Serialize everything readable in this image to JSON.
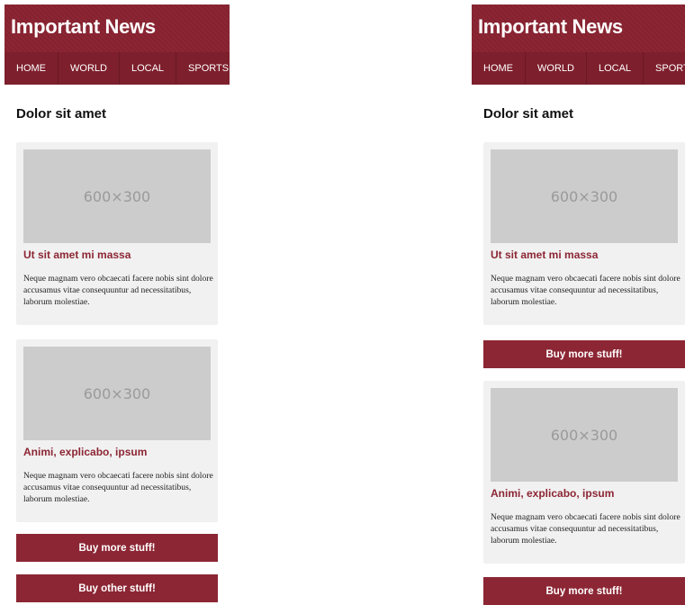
{
  "site": {
    "title": "Important News",
    "nav": [
      "HOME",
      "WORLD",
      "LOCAL",
      "SPORTS"
    ],
    "section_title": "Dolor sit amet"
  },
  "articles": [
    {
      "image_text": "600×300",
      "headline": "Ut sit amet mi massa",
      "body": "Neque magnam vero obcaecati facere nobis sint dolore accusamus vitae consequuntur ad necessitatibus, laborum molestiae."
    },
    {
      "image_text": "600×300",
      "headline": "Animi, explicabo, ipsum",
      "body": "Neque magnam vero obcaecati facere nobis sint dolore accusamus vitae consequuntur ad necessitatibus, laborum molestiae."
    }
  ],
  "buttons": {
    "buy_more": "Buy more stuff!",
    "buy_other": "Buy other stuff!"
  },
  "colors": {
    "brand": "#8c2634",
    "nav_bg": "#7d1f2c",
    "card_bg": "#f1f1f1",
    "placeholder_bg": "#cccccc"
  }
}
